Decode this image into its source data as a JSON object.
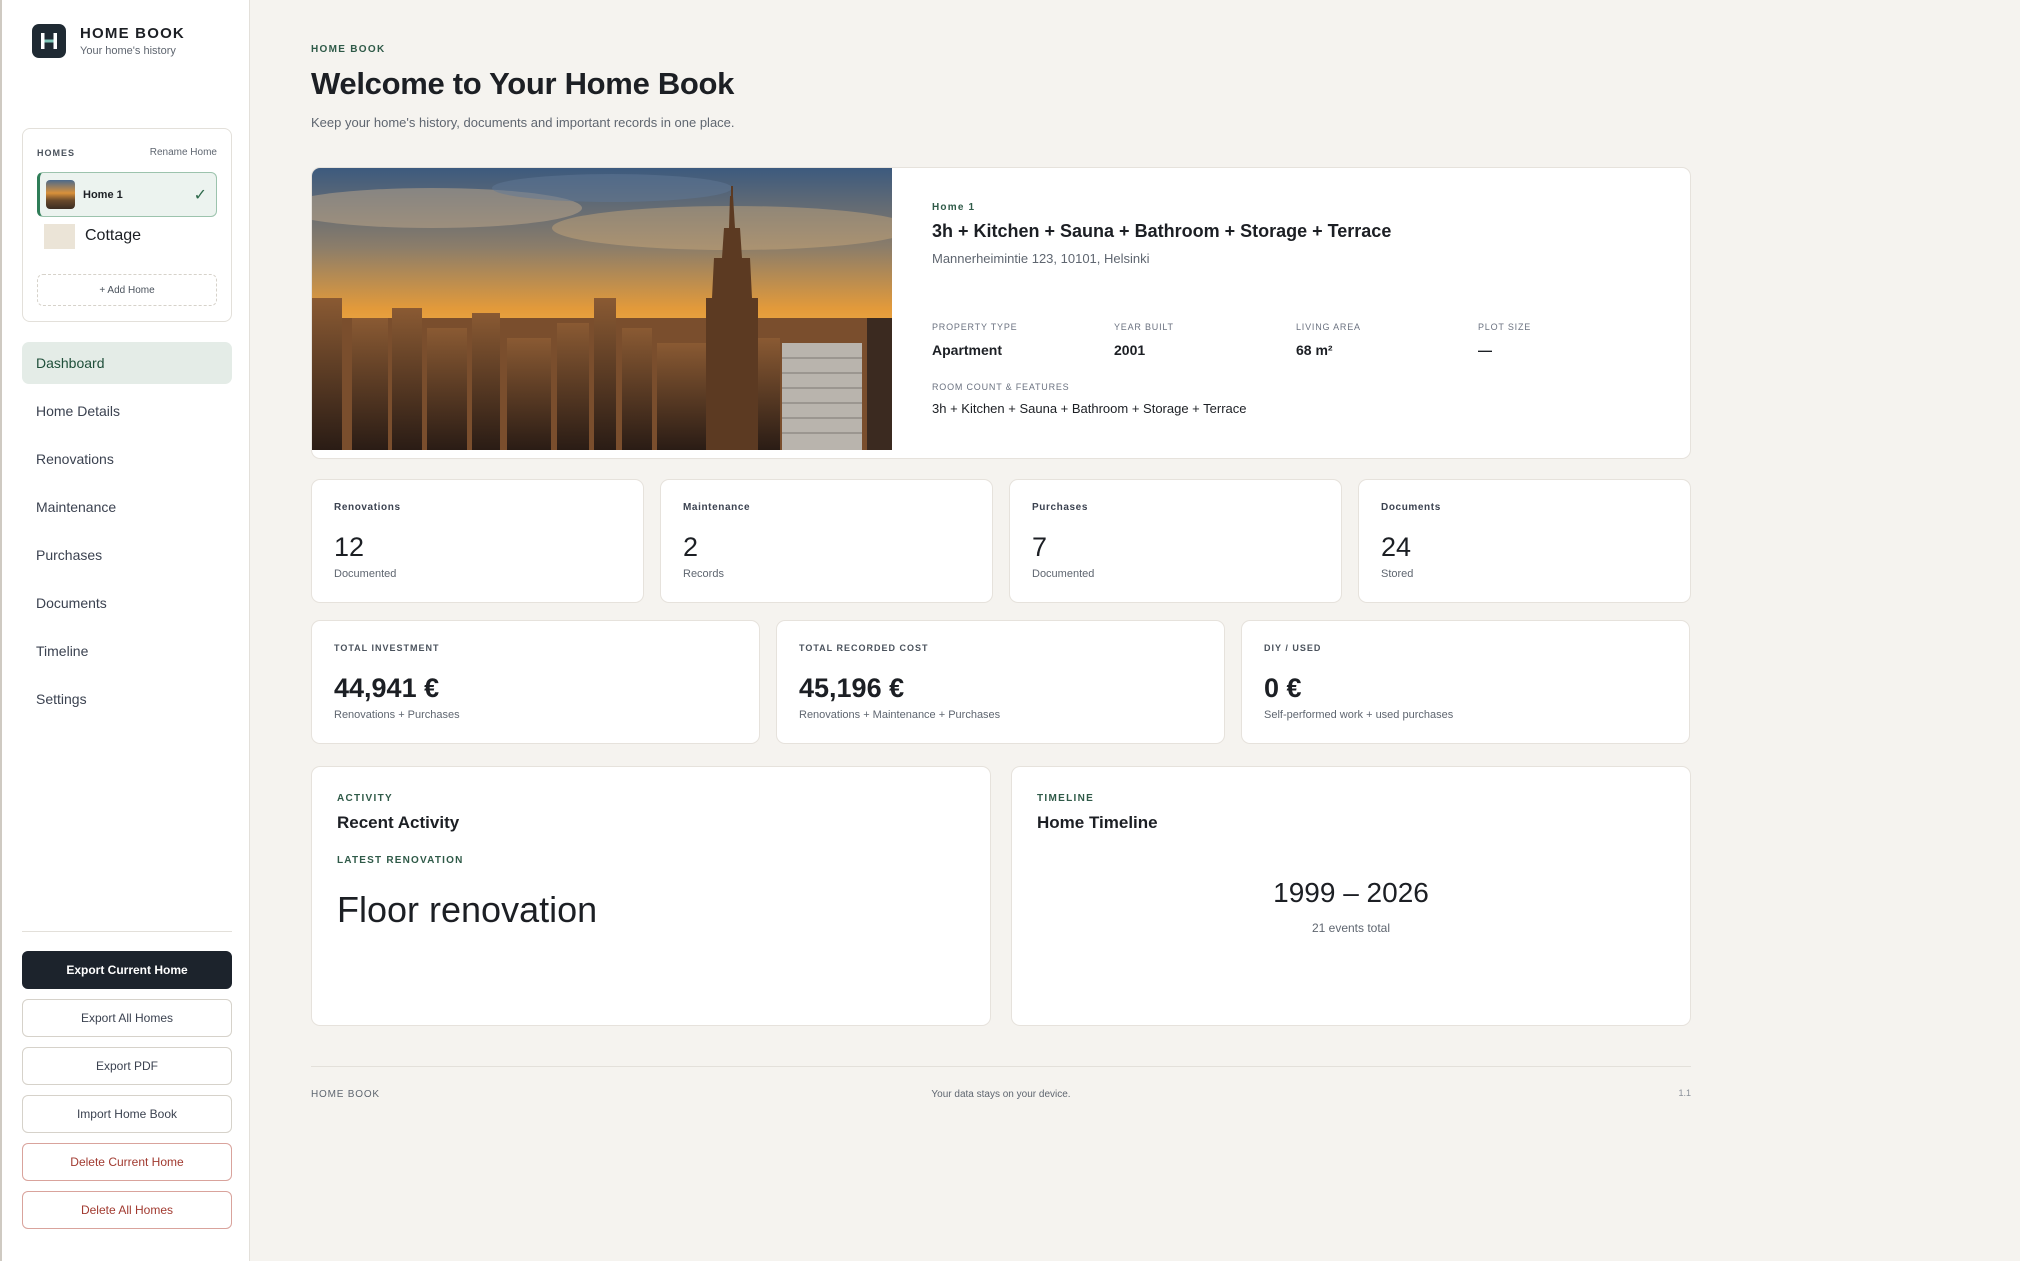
{
  "brand": {
    "title": "HOME BOOK",
    "subtitle": "Your home's history"
  },
  "homes": {
    "label": "HOMES",
    "rename_label": "Rename Home",
    "items": [
      {
        "name": "Home 1",
        "active": true
      },
      {
        "name": "Cottage",
        "active": false
      }
    ],
    "add_label": "+ Add Home"
  },
  "nav": [
    {
      "label": "Dashboard",
      "active": true
    },
    {
      "label": "Home Details"
    },
    {
      "label": "Renovations"
    },
    {
      "label": "Maintenance"
    },
    {
      "label": "Purchases"
    },
    {
      "label": "Documents"
    },
    {
      "label": "Timeline"
    },
    {
      "label": "Settings"
    }
  ],
  "actions": {
    "export_current": "Export Current Home",
    "export_all": "Export All Homes",
    "export_pdf": "Export PDF",
    "import": "Import Home Book",
    "delete_current": "Delete Current Home",
    "delete_all": "Delete All Homes"
  },
  "header": {
    "eyebrow": "HOME BOOK",
    "title": "Welcome to Your Home Book",
    "subtitle": "Keep your home's history, documents and important records in one place."
  },
  "hero": {
    "tag": "Home 1",
    "title": "3h + Kitchen + Sauna + Bathroom + Storage + Terrace",
    "address": "Mannerheimintie 123, 10101, Helsinki",
    "facts": [
      {
        "label": "PROPERTY TYPE",
        "value": "Apartment"
      },
      {
        "label": "YEAR BUILT",
        "value": "2001"
      },
      {
        "label": "LIVING AREA",
        "value": "68 m²"
      },
      {
        "label": "PLOT SIZE",
        "value": "—"
      }
    ],
    "features_label": "ROOM COUNT & FEATURES",
    "features_value": "3h + Kitchen + Sauna + Bathroom + Storage + Terrace"
  },
  "stats": [
    {
      "label": "Renovations",
      "value": "12",
      "sub": "Documented"
    },
    {
      "label": "Maintenance",
      "value": "2",
      "sub": "Records"
    },
    {
      "label": "Purchases",
      "value": "7",
      "sub": "Documented"
    },
    {
      "label": "Documents",
      "value": "24",
      "sub": "Stored"
    }
  ],
  "money": [
    {
      "label": "TOTAL INVESTMENT",
      "value": "44,941 €",
      "sub": "Renovations + Purchases"
    },
    {
      "label": "TOTAL RECORDED COST",
      "value": "45,196 €",
      "sub": "Renovations + Maintenance + Purchases"
    },
    {
      "label": "DIY / USED",
      "value": "0 €",
      "sub": "Self-performed work + used purchases"
    }
  ],
  "activity": {
    "eyebrow": "ACTIVITY",
    "title": "Recent Activity",
    "latest_label": "LATEST RENOVATION",
    "latest_value": "Floor renovation"
  },
  "timeline": {
    "eyebrow": "TIMELINE",
    "title": "Home Timeline",
    "range": "1999 – 2026",
    "count": "21 events total"
  },
  "footer": {
    "left": "HOME BOOK",
    "middle": "Your data stays on your device.",
    "version": "1.1"
  },
  "colors": {
    "accent": "#2f7d58",
    "dark": "#1c232c",
    "danger": "#a13a30",
    "background": "#f5f3ef"
  }
}
